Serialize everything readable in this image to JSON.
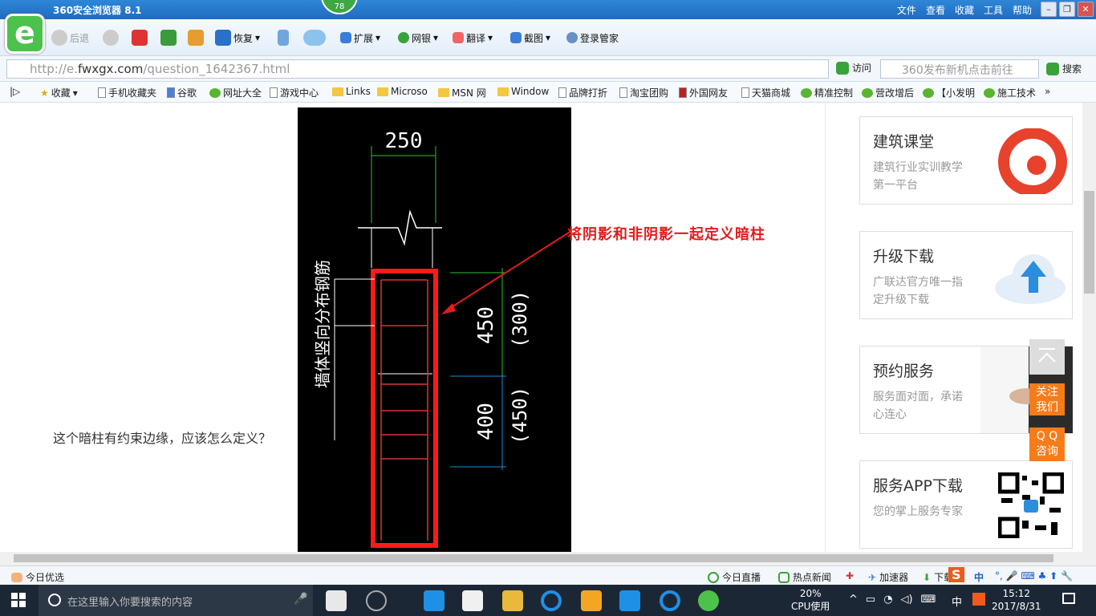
{
  "window": {
    "title": "360安全浏览器 8.1",
    "menu": [
      "文件",
      "查看",
      "收藏",
      "工具",
      "帮助"
    ],
    "badge": "78"
  },
  "toolbar": {
    "back": "后退",
    "restore": "恢复",
    "extend": "扩展",
    "bank": "网银",
    "translate": "翻译",
    "screenshot": "截图",
    "login": "登录管家"
  },
  "address": {
    "prefix": "http://e.",
    "domain": "fwxgx.com",
    "path": "/question_1642367.html",
    "go": "访问",
    "search_placeholder": "360发布新机点击前往",
    "search_btn": "搜索"
  },
  "favorites": [
    "收藏",
    "手机收藏夹",
    "谷歌",
    "网址大全",
    "游戏中心",
    "Links",
    "Microso",
    "MSN 网",
    "Window",
    "品牌打折",
    "淘宝团购",
    "外国网友",
    "天猫商城",
    "精准控制",
    "营改增后",
    "【小发明",
    "施工技术"
  ],
  "question": "这个暗柱有约束边缘，应该怎么定义？",
  "drawing": {
    "dim_top": "250",
    "dim_450": "450",
    "dim_300": "(300)",
    "dim_400": "400",
    "dim_450b": "(450)",
    "side_label": "墙体竖向分布钢筋",
    "annotation": "将阴影和非阴影一起定义暗柱"
  },
  "cards": [
    {
      "title": "建筑课堂",
      "desc": "建筑行业实训教学第一平台",
      "accent": "#e8412c"
    },
    {
      "title": "升级下载",
      "desc": "广联达官方唯一指定升级下载",
      "accent": "#2a8de0"
    },
    {
      "title": "预约服务",
      "desc": "服务面对面，承诺心连心",
      "accent": "#333333"
    },
    {
      "title": "服务APP下载",
      "desc": "您的掌上服务专家",
      "accent": "#000000"
    }
  ],
  "float": {
    "top_icon": "back-to-top-icon",
    "follow": "关注我们",
    "qq": "Q Q咨询"
  },
  "status": {
    "today": "今日优选",
    "live": "今日直播",
    "hot": "热点新闻",
    "speed": "加速器",
    "down": "下载",
    "ime": "中"
  },
  "taskbar": {
    "search": "在这里输入你要搜索的内容",
    "cpu": "20%",
    "cpu_label": "CPU使用",
    "ime": "中",
    "time": "15:12",
    "date": "2017/8/31"
  }
}
